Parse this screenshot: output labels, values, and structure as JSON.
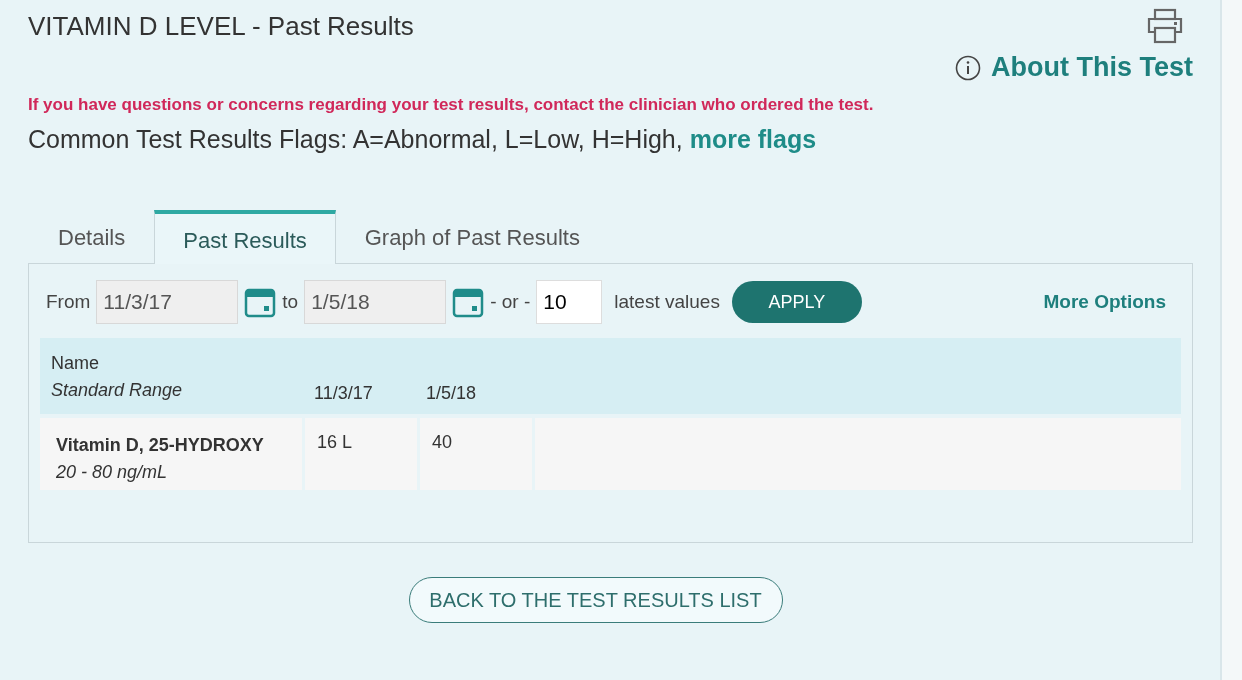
{
  "title": "VITAMIN D LEVEL - Past Results",
  "about_link": "About This Test",
  "notice": "If you have questions or concerns regarding your test results, contact the clinician who ordered the test.",
  "flags": {
    "text": "Common Test Results Flags: A=Abnormal, L=Low, H=High,",
    "link": "more flags"
  },
  "tabs": [
    {
      "label": "Details",
      "selected": false
    },
    {
      "label": "Past Results",
      "selected": true
    },
    {
      "label": "Graph of Past Results",
      "selected": false
    }
  ],
  "filter": {
    "from_label": "From",
    "from_value": "11/3/17",
    "to_label": "to",
    "to_value": "1/5/18",
    "or_label": "- or -",
    "count_value": "10",
    "count_suffix": "latest values",
    "apply": "APPLY",
    "more_options": "More Options"
  },
  "table": {
    "name_header": "Name",
    "range_header": "Standard Range",
    "dates": [
      "11/3/17",
      "1/5/18"
    ],
    "rows": [
      {
        "name": "Vitamin D, 25-HYDROXY",
        "range": "20 - 80 ng/mL",
        "values": [
          "16 L",
          "40"
        ]
      }
    ]
  },
  "back_button": "BACK TO THE TEST RESULTS LIST"
}
